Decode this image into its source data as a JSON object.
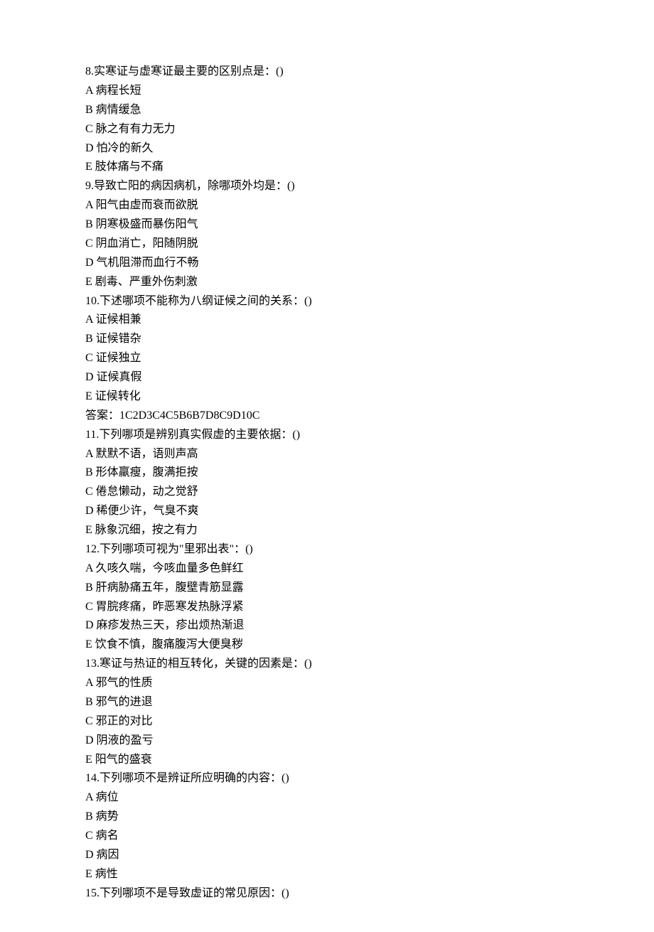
{
  "lines": [
    "8.实寒证与虚寒证最主要的区别点是：()",
    "A 病程长短",
    "B 病情缓急",
    "C 脉之有有力无力",
    "D 怕冷的新久",
    "E 肢体痛与不痛",
    "9.导致亡阳的病因病机，除哪项外均是：()",
    "A 阳气由虚而衰而欲脱",
    "B 阴寒极盛而暴伤阳气",
    "C 阴血消亡，阳随阴脱",
    "D 气机阻滞而血行不畅",
    "E 剧毒、严重外伤刺激",
    "10.下述哪项不能称为八纲证候之间的关系：()",
    "A 证候相兼",
    "B 证候错杂",
    "C 证候独立",
    "D 证候真假",
    "E 证候转化",
    "答案：1C2D3C4C5B6B7D8C9D10C",
    "11.下列哪项是辨别真实假虚的主要依据：()",
    "A 默默不语，语则声高",
    "B 形体羸瘦，腹满拒按",
    "C 倦怠懒动，动之觉舒",
    "D 稀便少许，气臭不爽",
    "E 脉象沉细，按之有力",
    "12.下列哪项可视为\"里邪出表\"：()",
    "A 久咳久喘，今咳血量多色鲜红",
    "B 肝病胁痛五年，腹壁青筋显露",
    "C 胃脘疼痛，昨恶寒发热脉浮紧",
    "D 麻疹发热三天，疹出烦热渐退",
    "E 饮食不慎，腹痛腹泻大便臭秽",
    "13.寒证与热证的相互转化，关键的因素是：()",
    "A 邪气的性质",
    "B 邪气的进退",
    "C 邪正的对比",
    "D 阴液的盈亏",
    "E 阳气的盛衰",
    "14.下列哪项不是辨证所应明确的内容：()",
    "A 病位",
    "B 病势",
    "C 病名",
    "D 病因",
    "E 病性",
    "15.下列哪项不是导致虚证的常见原因：()"
  ]
}
